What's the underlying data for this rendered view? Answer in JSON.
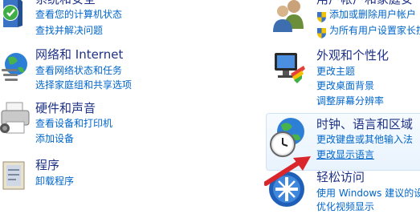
{
  "left": [
    {
      "id": "system-security",
      "title": "系统和安全",
      "links": [
        "查看您的计算机状态",
        "查找并解决问题"
      ]
    },
    {
      "id": "network",
      "title": "网络和 Internet",
      "links": [
        "查看网络状态和任务",
        "选择家庭组和共享选项"
      ]
    },
    {
      "id": "hardware",
      "title": "硬件和声音",
      "links": [
        "查看设备和打印机",
        "添加设备"
      ]
    },
    {
      "id": "programs",
      "title": "程序",
      "links": [
        "卸载程序"
      ]
    }
  ],
  "right": [
    {
      "id": "user-accounts",
      "title": "用户帐户和家庭安",
      "links": [
        "添加或删除用户帐户",
        "为所有用户设置家长控"
      ]
    },
    {
      "id": "appearance",
      "title": "外观和个性化",
      "links": [
        "更改主题",
        "更改桌面背景",
        "调整屏幕分辨率"
      ]
    },
    {
      "id": "clock-region",
      "title": "时钟、语言和区域",
      "links": [
        "更改键盘或其他输入法",
        "更改显示语言"
      ]
    },
    {
      "id": "ease-of-access",
      "title": "轻松访问",
      "links": [
        "使用 Windows 建议的设",
        "优化视频显示"
      ]
    }
  ],
  "colors": {
    "title": "#1e3287",
    "link": "#0066cc",
    "highlight_border": "#cfe3f7",
    "arrow": "#d9262c"
  }
}
